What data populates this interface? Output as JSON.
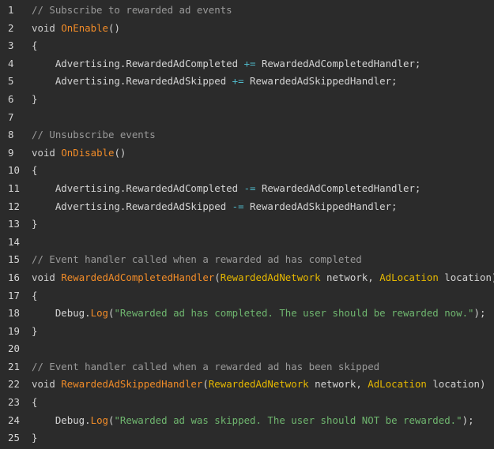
{
  "editor": {
    "colors": {
      "background": "#2b2b2b",
      "comment": "#9a9a9a",
      "function": "#f28c28",
      "type": "#e6b800",
      "string": "#6fb66f",
      "operator": "#4fb8c8",
      "text": "#d4d4d4"
    },
    "lines": [
      {
        "num": "1",
        "tokens": [
          {
            "t": "comment",
            "v": "// Subscribe to rewarded ad events"
          }
        ]
      },
      {
        "num": "2",
        "tokens": [
          {
            "t": "keyword",
            "v": "void "
          },
          {
            "t": "func",
            "v": "OnEnable"
          },
          {
            "t": "text",
            "v": "()"
          }
        ]
      },
      {
        "num": "3",
        "tokens": [
          {
            "t": "text",
            "v": "{"
          }
        ]
      },
      {
        "num": "4",
        "tokens": [
          {
            "t": "text",
            "v": "    Advertising.RewardedAdCompleted "
          },
          {
            "t": "op",
            "v": "+="
          },
          {
            "t": "text",
            "v": " RewardedAdCompletedHandler;"
          }
        ]
      },
      {
        "num": "5",
        "tokens": [
          {
            "t": "text",
            "v": "    Advertising.RewardedAdSkipped "
          },
          {
            "t": "op",
            "v": "+="
          },
          {
            "t": "text",
            "v": " RewardedAdSkippedHandler;"
          }
        ]
      },
      {
        "num": "6",
        "tokens": [
          {
            "t": "text",
            "v": "}"
          }
        ]
      },
      {
        "num": "7",
        "tokens": []
      },
      {
        "num": "8",
        "tokens": [
          {
            "t": "comment",
            "v": "// Unsubscribe events"
          }
        ]
      },
      {
        "num": "9",
        "tokens": [
          {
            "t": "keyword",
            "v": "void "
          },
          {
            "t": "func",
            "v": "OnDisable"
          },
          {
            "t": "text",
            "v": "()"
          }
        ]
      },
      {
        "num": "10",
        "tokens": [
          {
            "t": "text",
            "v": "{"
          }
        ]
      },
      {
        "num": "11",
        "tokens": [
          {
            "t": "text",
            "v": "    Advertising.RewardedAdCompleted "
          },
          {
            "t": "op",
            "v": "-="
          },
          {
            "t": "text",
            "v": " RewardedAdCompletedHandler;"
          }
        ]
      },
      {
        "num": "12",
        "tokens": [
          {
            "t": "text",
            "v": "    Advertising.RewardedAdSkipped "
          },
          {
            "t": "op",
            "v": "-="
          },
          {
            "t": "text",
            "v": " RewardedAdSkippedHandler;"
          }
        ]
      },
      {
        "num": "13",
        "tokens": [
          {
            "t": "text",
            "v": "}"
          }
        ]
      },
      {
        "num": "14",
        "tokens": []
      },
      {
        "num": "15",
        "tokens": [
          {
            "t": "comment",
            "v": "// Event handler called when a rewarded ad has completed"
          }
        ]
      },
      {
        "num": "16",
        "tokens": [
          {
            "t": "keyword",
            "v": "void "
          },
          {
            "t": "func",
            "v": "RewardedAdCompletedHandler"
          },
          {
            "t": "text",
            "v": "("
          },
          {
            "t": "type",
            "v": "RewardedAdNetwork"
          },
          {
            "t": "text",
            "v": " network, "
          },
          {
            "t": "type",
            "v": "AdLocation"
          },
          {
            "t": "text",
            "v": " location)"
          }
        ]
      },
      {
        "num": "17",
        "tokens": [
          {
            "t": "text",
            "v": "{"
          }
        ]
      },
      {
        "num": "18",
        "tokens": [
          {
            "t": "text",
            "v": "    Debug."
          },
          {
            "t": "func",
            "v": "Log"
          },
          {
            "t": "text",
            "v": "("
          },
          {
            "t": "string",
            "v": "\"Rewarded ad has completed. The user should be rewarded now.\""
          },
          {
            "t": "text",
            "v": ");"
          }
        ]
      },
      {
        "num": "19",
        "tokens": [
          {
            "t": "text",
            "v": "}"
          }
        ]
      },
      {
        "num": "20",
        "tokens": []
      },
      {
        "num": "21",
        "tokens": [
          {
            "t": "comment",
            "v": "// Event handler called when a rewarded ad has been skipped"
          }
        ]
      },
      {
        "num": "22",
        "tokens": [
          {
            "t": "keyword",
            "v": "void "
          },
          {
            "t": "func",
            "v": "RewardedAdSkippedHandler"
          },
          {
            "t": "text",
            "v": "("
          },
          {
            "t": "type",
            "v": "RewardedAdNetwork"
          },
          {
            "t": "text",
            "v": " network, "
          },
          {
            "t": "type",
            "v": "AdLocation"
          },
          {
            "t": "text",
            "v": " location)"
          }
        ]
      },
      {
        "num": "23",
        "tokens": [
          {
            "t": "text",
            "v": "{"
          }
        ]
      },
      {
        "num": "24",
        "tokens": [
          {
            "t": "text",
            "v": "    Debug."
          },
          {
            "t": "func",
            "v": "Log"
          },
          {
            "t": "text",
            "v": "("
          },
          {
            "t": "string",
            "v": "\"Rewarded ad was skipped. The user should NOT be rewarded.\""
          },
          {
            "t": "text",
            "v": ");"
          }
        ]
      },
      {
        "num": "25",
        "tokens": [
          {
            "t": "text",
            "v": "}"
          }
        ]
      }
    ]
  }
}
